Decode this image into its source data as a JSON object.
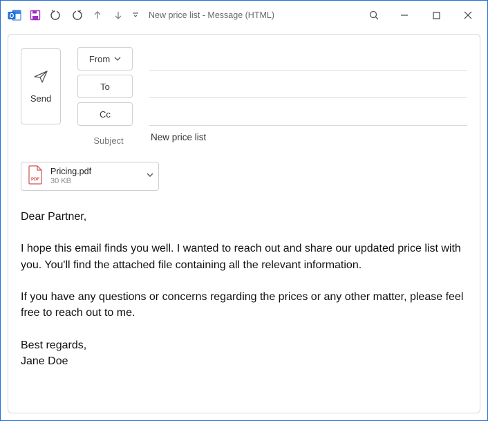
{
  "titlebar": {
    "title": "New price list  -  Message (HTML)"
  },
  "compose": {
    "send_label": "Send",
    "from_label": "From",
    "to_label": "To",
    "cc_label": "Cc",
    "subject_label": "Subject",
    "subject_value": "New price list",
    "to_value": "",
    "cc_value": "",
    "from_value": ""
  },
  "attachment": {
    "name": "Pricing.pdf",
    "size": "30 KB"
  },
  "body": "Dear Partner,\n\nI hope this email finds you well. I wanted to reach out and share our updated price list with you. You'll find the attached file containing all the relevant information.\n\nIf you have any questions or concerns regarding the prices or any other matter, please feel free to reach out to me.\n\nBest regards,\nJane Doe"
}
